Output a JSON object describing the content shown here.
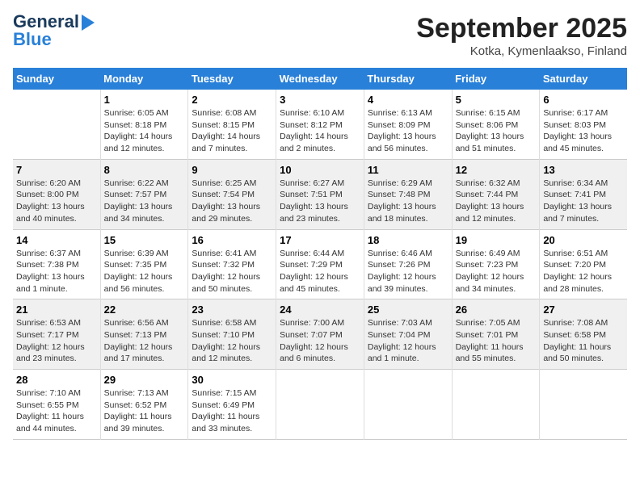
{
  "logo": {
    "line1": "General",
    "line2": "Blue"
  },
  "title": "September 2025",
  "subtitle": "Kotka, Kymenlaakso, Finland",
  "days_of_week": [
    "Sunday",
    "Monday",
    "Tuesday",
    "Wednesday",
    "Thursday",
    "Friday",
    "Saturday"
  ],
  "weeks": [
    [
      {
        "day": "",
        "info": ""
      },
      {
        "day": "1",
        "info": "Sunrise: 6:05 AM\nSunset: 8:18 PM\nDaylight: 14 hours\nand 12 minutes."
      },
      {
        "day": "2",
        "info": "Sunrise: 6:08 AM\nSunset: 8:15 PM\nDaylight: 14 hours\nand 7 minutes."
      },
      {
        "day": "3",
        "info": "Sunrise: 6:10 AM\nSunset: 8:12 PM\nDaylight: 14 hours\nand 2 minutes."
      },
      {
        "day": "4",
        "info": "Sunrise: 6:13 AM\nSunset: 8:09 PM\nDaylight: 13 hours\nand 56 minutes."
      },
      {
        "day": "5",
        "info": "Sunrise: 6:15 AM\nSunset: 8:06 PM\nDaylight: 13 hours\nand 51 minutes."
      },
      {
        "day": "6",
        "info": "Sunrise: 6:17 AM\nSunset: 8:03 PM\nDaylight: 13 hours\nand 45 minutes."
      }
    ],
    [
      {
        "day": "7",
        "info": "Sunrise: 6:20 AM\nSunset: 8:00 PM\nDaylight: 13 hours\nand 40 minutes."
      },
      {
        "day": "8",
        "info": "Sunrise: 6:22 AM\nSunset: 7:57 PM\nDaylight: 13 hours\nand 34 minutes."
      },
      {
        "day": "9",
        "info": "Sunrise: 6:25 AM\nSunset: 7:54 PM\nDaylight: 13 hours\nand 29 minutes."
      },
      {
        "day": "10",
        "info": "Sunrise: 6:27 AM\nSunset: 7:51 PM\nDaylight: 13 hours\nand 23 minutes."
      },
      {
        "day": "11",
        "info": "Sunrise: 6:29 AM\nSunset: 7:48 PM\nDaylight: 13 hours\nand 18 minutes."
      },
      {
        "day": "12",
        "info": "Sunrise: 6:32 AM\nSunset: 7:44 PM\nDaylight: 13 hours\nand 12 minutes."
      },
      {
        "day": "13",
        "info": "Sunrise: 6:34 AM\nSunset: 7:41 PM\nDaylight: 13 hours\nand 7 minutes."
      }
    ],
    [
      {
        "day": "14",
        "info": "Sunrise: 6:37 AM\nSunset: 7:38 PM\nDaylight: 13 hours\nand 1 minute."
      },
      {
        "day": "15",
        "info": "Sunrise: 6:39 AM\nSunset: 7:35 PM\nDaylight: 12 hours\nand 56 minutes."
      },
      {
        "day": "16",
        "info": "Sunrise: 6:41 AM\nSunset: 7:32 PM\nDaylight: 12 hours\nand 50 minutes."
      },
      {
        "day": "17",
        "info": "Sunrise: 6:44 AM\nSunset: 7:29 PM\nDaylight: 12 hours\nand 45 minutes."
      },
      {
        "day": "18",
        "info": "Sunrise: 6:46 AM\nSunset: 7:26 PM\nDaylight: 12 hours\nand 39 minutes."
      },
      {
        "day": "19",
        "info": "Sunrise: 6:49 AM\nSunset: 7:23 PM\nDaylight: 12 hours\nand 34 minutes."
      },
      {
        "day": "20",
        "info": "Sunrise: 6:51 AM\nSunset: 7:20 PM\nDaylight: 12 hours\nand 28 minutes."
      }
    ],
    [
      {
        "day": "21",
        "info": "Sunrise: 6:53 AM\nSunset: 7:17 PM\nDaylight: 12 hours\nand 23 minutes."
      },
      {
        "day": "22",
        "info": "Sunrise: 6:56 AM\nSunset: 7:13 PM\nDaylight: 12 hours\nand 17 minutes."
      },
      {
        "day": "23",
        "info": "Sunrise: 6:58 AM\nSunset: 7:10 PM\nDaylight: 12 hours\nand 12 minutes."
      },
      {
        "day": "24",
        "info": "Sunrise: 7:00 AM\nSunset: 7:07 PM\nDaylight: 12 hours\nand 6 minutes."
      },
      {
        "day": "25",
        "info": "Sunrise: 7:03 AM\nSunset: 7:04 PM\nDaylight: 12 hours\nand 1 minute."
      },
      {
        "day": "26",
        "info": "Sunrise: 7:05 AM\nSunset: 7:01 PM\nDaylight: 11 hours\nand 55 minutes."
      },
      {
        "day": "27",
        "info": "Sunrise: 7:08 AM\nSunset: 6:58 PM\nDaylight: 11 hours\nand 50 minutes."
      }
    ],
    [
      {
        "day": "28",
        "info": "Sunrise: 7:10 AM\nSunset: 6:55 PM\nDaylight: 11 hours\nand 44 minutes."
      },
      {
        "day": "29",
        "info": "Sunrise: 7:13 AM\nSunset: 6:52 PM\nDaylight: 11 hours\nand 39 minutes."
      },
      {
        "day": "30",
        "info": "Sunrise: 7:15 AM\nSunset: 6:49 PM\nDaylight: 11 hours\nand 33 minutes."
      },
      {
        "day": "",
        "info": ""
      },
      {
        "day": "",
        "info": ""
      },
      {
        "day": "",
        "info": ""
      },
      {
        "day": "",
        "info": ""
      }
    ]
  ],
  "colors": {
    "header_bg": "#2980d9",
    "header_text": "#ffffff",
    "accent": "#1a3a5c"
  }
}
